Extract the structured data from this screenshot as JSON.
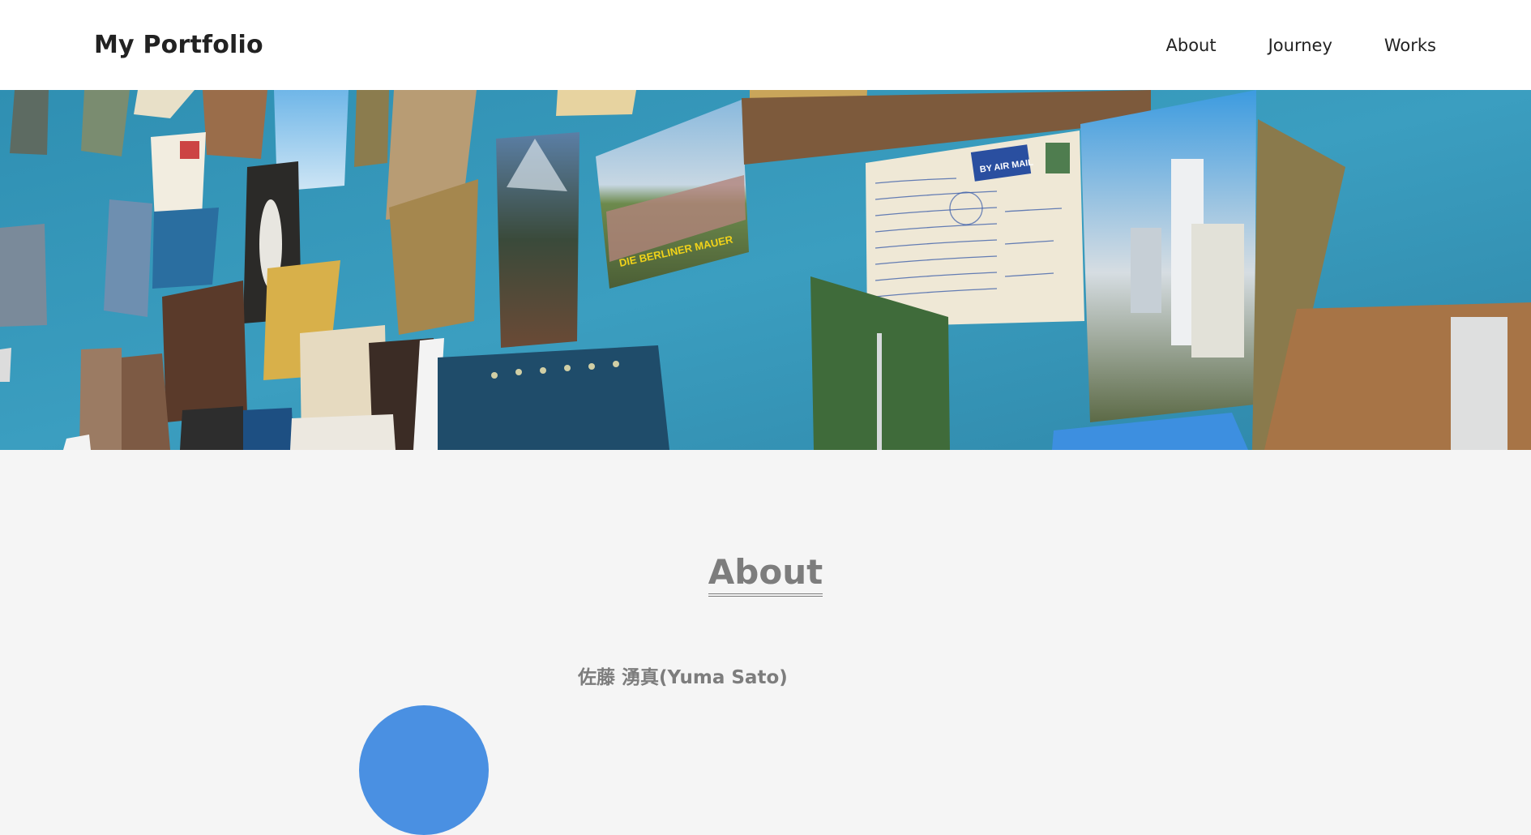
{
  "header": {
    "logo": "My Portfolio",
    "nav": [
      "About",
      "Journey",
      "Works"
    ]
  },
  "hero": {
    "image": "postcard-wall",
    "postcard_texts": {
      "berlin": "DIE BERLINER MAUER",
      "airmail": "BY AIR MAIL"
    }
  },
  "about": {
    "title": "About",
    "name": "佐藤 湧真(Yuma Sato)"
  },
  "colors": {
    "header_bg": "#ffffff",
    "page_bg": "#f5f5f5",
    "accent_gray": "#7d7d7d",
    "avatar_blue": "#4a90e2",
    "wall_blue": "#3a97b8"
  }
}
